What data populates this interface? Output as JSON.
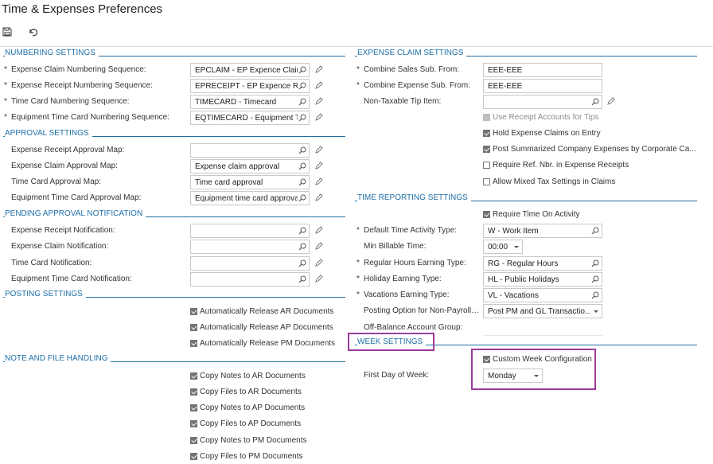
{
  "page": {
    "title": "Time & Expenses Preferences",
    "toolbar": {
      "save_icon": "save-icon",
      "undo_icon": "undo-icon"
    }
  },
  "colors": {
    "section_title": "#1f6fa8",
    "highlight": "#9b3b9b",
    "checkbox_checked": "#737373"
  },
  "left": {
    "numbering": {
      "title": "NUMBERING SETTINGS",
      "rows": [
        {
          "label": "Expense Claim Numbering Sequence:",
          "value": "EPCLAIM - EP Expence Clair",
          "required": true
        },
        {
          "label": "Expense Receipt Numbering Sequence:",
          "value": "EPRECEIPT - EP Expence R",
          "required": true
        },
        {
          "label": "Time Card Numbering Sequence:",
          "value": "TIMECARD - Timecard",
          "required": true
        },
        {
          "label": "Equipment Time Card Numbering Sequence:",
          "value": "EQTIMECARD - Equipment T",
          "required": true
        }
      ]
    },
    "approval": {
      "title": "APPROVAL SETTINGS",
      "rows": [
        {
          "label": "Expense Receipt Approval Map:",
          "value": ""
        },
        {
          "label": "Expense Claim Approval Map:",
          "value": "Expense claim approval"
        },
        {
          "label": "Time Card Approval Map:",
          "value": "Time card approval"
        },
        {
          "label": "Equipment Time Card Approval Map:",
          "value": "Equipment time card approva"
        }
      ]
    },
    "pending": {
      "title": "PENDING APPROVAL NOTIFICATION",
      "rows": [
        {
          "label": "Expense Receipt Notification:",
          "value": ""
        },
        {
          "label": "Expense Claim Notification:",
          "value": ""
        },
        {
          "label": "Time Card Notification:",
          "value": ""
        },
        {
          "label": "Equipment Time Card Notification:",
          "value": ""
        }
      ]
    },
    "posting": {
      "title": "POSTING SETTINGS",
      "checks": [
        {
          "label": "Automatically Release AR Documents",
          "checked": true
        },
        {
          "label": "Automatically Release AP Documents",
          "checked": true
        },
        {
          "label": "Automatically Release PM Documents",
          "checked": true
        }
      ]
    },
    "notes": {
      "title": "NOTE AND FILE HANDLING",
      "checks": [
        {
          "label": "Copy Notes to AR Documents",
          "checked": true
        },
        {
          "label": "Copy Files to AR Documents",
          "checked": true
        },
        {
          "label": "Copy Notes to AP Documents",
          "checked": true
        },
        {
          "label": "Copy Files to AP Documents",
          "checked": true
        },
        {
          "label": "Copy Notes to PM Documents",
          "checked": true
        },
        {
          "label": "Copy Files to PM Documents",
          "checked": true
        }
      ]
    }
  },
  "right": {
    "expense": {
      "title": "EXPENSE CLAIM SETTINGS",
      "combine_sales_label": "Combine Sales Sub. From:",
      "combine_sales_value": "EEE-EEE",
      "combine_expense_label": "Combine Expense Sub. From:",
      "combine_expense_value": "EEE-EEE",
      "tip_label": "Non-Taxable Tip Item:",
      "tip_value": "",
      "checks": [
        {
          "label": "Use Receipt Accounts for Tips",
          "checked": false,
          "disabled": true
        },
        {
          "label": "Hold Expense Claims on Entry",
          "checked": true
        },
        {
          "label": "Post Summarized Company Expenses by Corporate Ca...",
          "checked": true
        },
        {
          "label": "Require Ref. Nbr. in Expense Receipts",
          "checked": false
        },
        {
          "label": "Allow Mixed Tax Settings in Claims",
          "checked": false
        }
      ]
    },
    "time": {
      "title": "TIME REPORTING SETTINGS",
      "require_label": "Require Time On Activity",
      "default_activity_label": "Default Time Activity Type:",
      "default_activity_value": "W - Work Item",
      "min_billable_label": "Min Billable Time:",
      "min_billable_value": "00:00",
      "regular_label": "Regular Hours Earning Type:",
      "regular_value": "RG - Regular Hours",
      "holiday_label": "Holiday Earning Type:",
      "holiday_value": "HL - Public Holidays",
      "vacations_label": "Vacations Earning Type:",
      "vacations_value": "VL - Vacations",
      "posting_option_label": "Posting Option for Non-Payroll ...",
      "posting_option_value": "Post PM and GL Transactio...",
      "offbalance_label": "Off-Balance Account Group:",
      "offbalance_value": ""
    },
    "week": {
      "title": "WEEK SETTINGS",
      "custom_label": "Custom Week Configuration",
      "first_day_label": "First Day of Week:",
      "first_day_value": "Monday"
    }
  }
}
